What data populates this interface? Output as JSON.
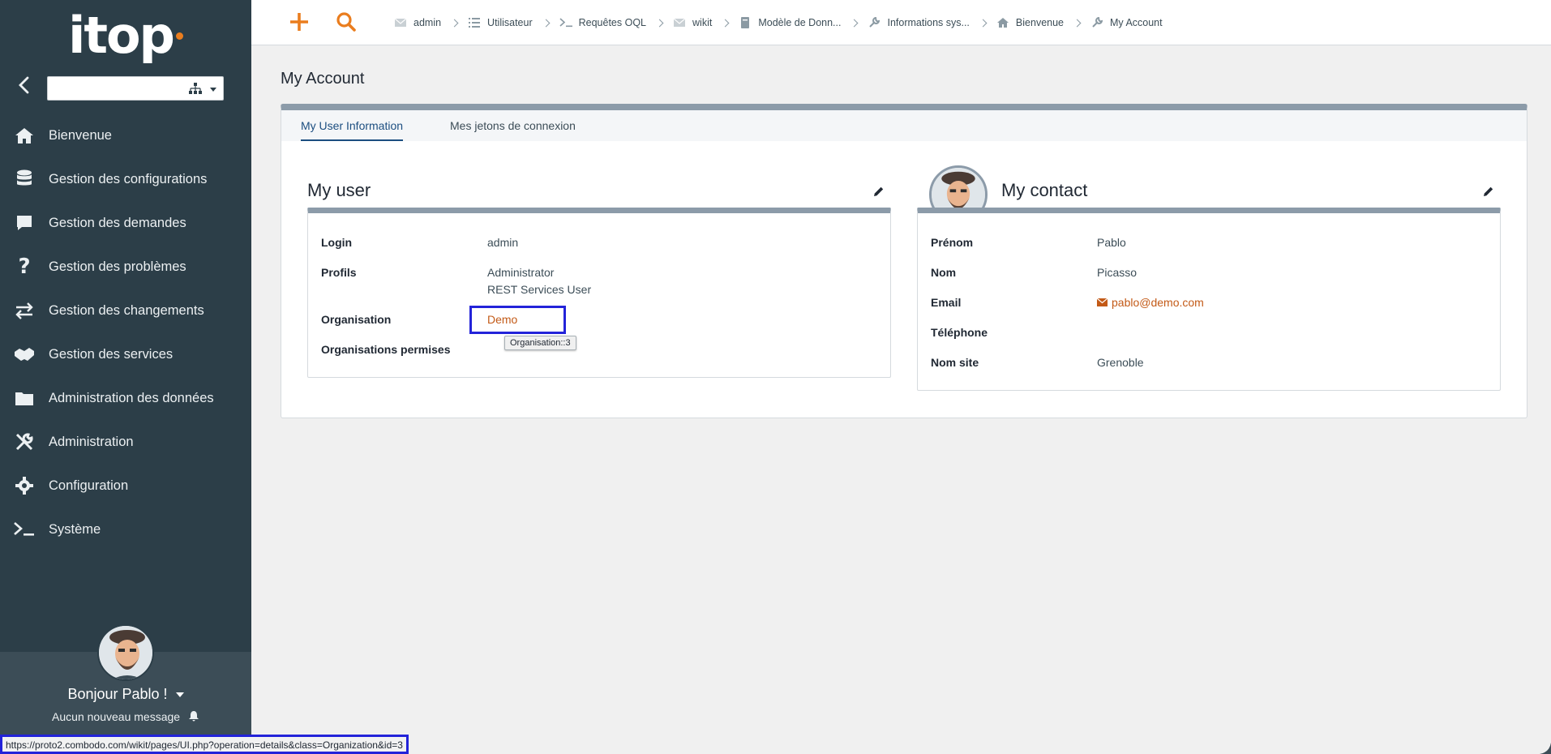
{
  "app": {
    "logo_text": "itop"
  },
  "sidebar": {
    "items": [
      {
        "label": "Bienvenue",
        "icon": "home-icon"
      },
      {
        "label": "Gestion des configurations",
        "icon": "database-icon"
      },
      {
        "label": "Gestion des demandes",
        "icon": "comment-icon"
      },
      {
        "label": "Gestion des problèmes",
        "icon": "question-icon"
      },
      {
        "label": "Gestion des changements",
        "icon": "exchange-icon"
      },
      {
        "label": "Gestion des services",
        "icon": "handshake-icon"
      },
      {
        "label": "Administration des données",
        "icon": "folder-icon"
      },
      {
        "label": "Administration",
        "icon": "tools-icon"
      },
      {
        "label": "Configuration",
        "icon": "gear-icon"
      },
      {
        "label": "Système",
        "icon": "terminal-icon"
      }
    ],
    "org_select_value": "",
    "user": {
      "greeting": "Bonjour Pablo !",
      "messages": "Aucun nouveau message"
    }
  },
  "topbar": {
    "breadcrumbs": [
      {
        "label": "admin",
        "icon": "envelope-icon"
      },
      {
        "label": "Utilisateur",
        "icon": "list-icon"
      },
      {
        "label": "Requêtes OQL",
        "icon": "terminal-icon"
      },
      {
        "label": "wikit",
        "icon": "envelope-icon"
      },
      {
        "label": "Modèle de Donn...",
        "icon": "book-icon"
      },
      {
        "label": "Informations sys...",
        "icon": "wrench-icon"
      },
      {
        "label": "Bienvenue",
        "icon": "home-icon"
      },
      {
        "label": "My Account",
        "icon": "wrench-icon"
      }
    ]
  },
  "page": {
    "title": "My Account",
    "tabs": [
      {
        "label": "My User Information",
        "active": true
      },
      {
        "label": "Mes jetons de connexion",
        "active": false
      }
    ],
    "my_user": {
      "heading": "My user",
      "login_label": "Login",
      "login_value": "admin",
      "profiles_label": "Profils",
      "profiles": [
        "Administrator",
        "REST Services User"
      ],
      "org_label": "Organisation",
      "org_value": "Demo",
      "org_tooltip": "Organisation::3",
      "allowed_orgs_label": "Organisations permises"
    },
    "my_contact": {
      "heading": "My contact",
      "firstname_label": "Prénom",
      "firstname_value": "Pablo",
      "name_label": "Nom",
      "name_value": "Picasso",
      "email_label": "Email",
      "email_value": "pablo@demo.com",
      "phone_label": "Téléphone",
      "phone_value": "",
      "site_label": "Nom site",
      "site_value": "Grenoble"
    }
  },
  "statusbar": {
    "url": "https://proto2.combodo.com/wikit/pages/UI.php?operation=details&class=Organization&id=3"
  },
  "colors": {
    "accent": "#ea7d1e",
    "sidebar_bg": "#2c3e48",
    "link": "#c35a17",
    "active_tab": "#1c4e80",
    "highlight": "#2323d9"
  }
}
